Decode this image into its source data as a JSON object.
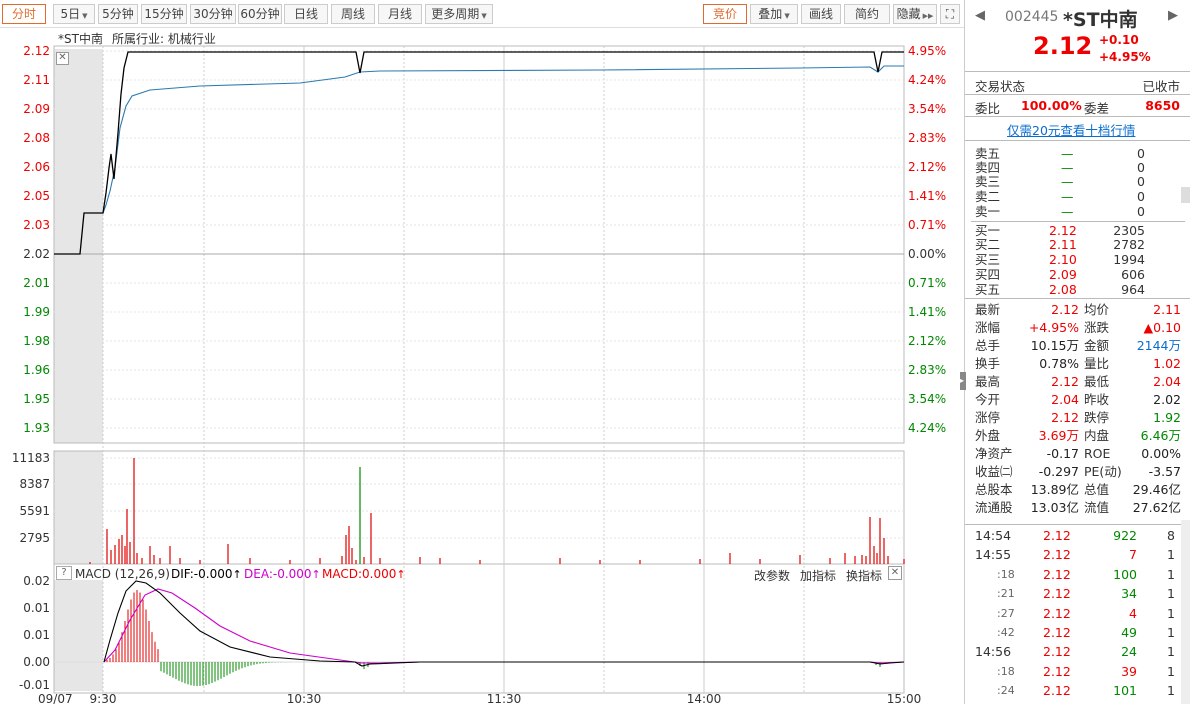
{
  "toolbar": {
    "tabs": [
      "分时",
      "5日",
      "5分钟",
      "15分钟",
      "30分钟",
      "60分钟",
      "日线",
      "周线",
      "月线",
      "更多周期"
    ],
    "right_tabs": [
      "竞价",
      "叠加",
      "画线",
      "简约",
      "隐藏"
    ]
  },
  "chart": {
    "title": "*ST中南",
    "industry": "所属行业: 机械行业",
    "price_ticks": [
      "2.12",
      "2.11",
      "2.09",
      "2.08",
      "2.06",
      "2.05",
      "2.03",
      "2.02",
      "2.01",
      "1.99",
      "1.98",
      "1.96",
      "1.95",
      "1.93"
    ],
    "pct_ticks": [
      "4.95%",
      "4.24%",
      "3.54%",
      "2.83%",
      "2.12%",
      "1.41%",
      "0.71%",
      "0.00%",
      "0.71%",
      "1.41%",
      "2.12%",
      "2.83%",
      "3.54%",
      "4.24%"
    ],
    "vol_ticks": [
      "11183",
      "8387",
      "5591",
      "2795"
    ],
    "macd_ticks": [
      "0.02",
      "0.01",
      "0.01",
      "0.00",
      "-0.01"
    ],
    "time_ticks": [
      "09/07",
      "9:30",
      "10:30",
      "11:30",
      "14:00",
      "15:00"
    ],
    "macd_header": {
      "label": "MACD (12,26,9)",
      "dif": "DIF:-0.000",
      "dea": "DEA:-0.000",
      "macd": "MACD:0.000",
      "adjust": "改参数",
      "add": "加指标",
      "swap": "换指标"
    },
    "colors": {
      "price": "#000000",
      "avg": "#2a7ab0",
      "up": "#e00000",
      "down": "#008800",
      "dif": "#000000",
      "dea": "#cc00cc"
    }
  },
  "chart_data": [
    {
      "type": "line",
      "title": "*ST中南",
      "x": [
        "9:30",
        "9:32",
        "9:33",
        "9:35",
        "9:37",
        "9:38",
        "9:40",
        "10:00",
        "10:30",
        "11:00",
        "11:20",
        "11:23",
        "11:30",
        "13:00",
        "14:00",
        "14:50",
        "14:51",
        "14:52",
        "15:00"
      ],
      "series": [
        {
          "values": [
            2.03,
            2.03,
            2.06,
            2.05,
            2.11,
            2.12,
            2.12,
            2.12,
            2.12,
            2.12,
            2.12,
            2.115,
            2.12,
            2.12,
            2.12,
            2.12,
            2.115,
            2.12,
            2.12
          ]
        },
        {
          "values": [
            2.03,
            2.03,
            2.045,
            2.05,
            2.08,
            2.095,
            2.1,
            2.103,
            2.104,
            2.105,
            2.107,
            2.109,
            2.11,
            2.11,
            2.11,
            2.112,
            2.111,
            2.112,
            2.112
          ]
        }
      ],
      "ylim": [
        1.92,
        2.12
      ],
      "y_axis_left": [
        "2.12",
        "2.11",
        "2.09",
        "2.08",
        "2.06",
        "2.05",
        "2.03",
        "2.02",
        "2.01",
        "1.99",
        "1.98",
        "1.96",
        "1.95",
        "1.93"
      ],
      "y_axis_right": [
        "4.95%",
        "4.24%",
        "3.54%",
        "2.83%",
        "2.12%",
        "1.41%",
        "0.71%",
        "0.00%",
        "0.71%",
        "1.41%",
        "2.12%",
        "2.83%",
        "3.54%",
        "4.24%"
      ]
    },
    {
      "type": "bar",
      "ylim": [
        0,
        11183
      ],
      "y_ticks": [
        "11183",
        "8387",
        "5591",
        "2795"
      ]
    },
    {
      "type": "bar",
      "ylim": [
        -0.01,
        0.02
      ],
      "y_ticks": [
        "0.02",
        "0.01",
        "0.01",
        "0.00",
        "-0.01"
      ],
      "series": [
        {
          "name": "MACD"
        },
        {
          "name": "DIF"
        },
        {
          "name": "DEA"
        }
      ]
    }
  ],
  "quote": {
    "code": "002445",
    "name": "*ST中南",
    "price": "2.12",
    "change": "+0.10",
    "change_pct": "+4.95%",
    "status_label": "交易状态",
    "status_value": "已收市",
    "weibi_label": "委比",
    "weibi_value": "100.00%",
    "weicha_label": "委差",
    "weicha_value": "8650",
    "link": "仅需20元查看十档行情",
    "asks": [
      {
        "label": "卖五",
        "price": "—",
        "vol": "0"
      },
      {
        "label": "卖四",
        "price": "—",
        "vol": "0"
      },
      {
        "label": "卖三",
        "price": "—",
        "vol": "0"
      },
      {
        "label": "卖二",
        "price": "—",
        "vol": "0"
      },
      {
        "label": "卖一",
        "price": "—",
        "vol": "0"
      }
    ],
    "bids": [
      {
        "label": "买一",
        "price": "2.12",
        "vol": "2305"
      },
      {
        "label": "买二",
        "price": "2.11",
        "vol": "2782"
      },
      {
        "label": "买三",
        "price": "2.10",
        "vol": "1994"
      },
      {
        "label": "买四",
        "price": "2.09",
        "vol": "606"
      },
      {
        "label": "买五",
        "price": "2.08",
        "vol": "964"
      }
    ],
    "stats": [
      {
        "l1": "最新",
        "v1": "2.12",
        "c1": "r",
        "l2": "均价",
        "v2": "2.11",
        "c2": "r"
      },
      {
        "l1": "涨幅",
        "v1": "+4.95%",
        "c1": "r",
        "l2": "涨跌",
        "v2": "▲0.10",
        "c2": "r"
      },
      {
        "l1": "总手",
        "v1": "10.15万",
        "c1": "k",
        "l2": "金额",
        "v2": "2144万",
        "c2": "b"
      },
      {
        "l1": "换手",
        "v1": "0.78%",
        "c1": "k",
        "l2": "量比",
        "v2": "1.02",
        "c2": "r"
      },
      {
        "l1": "最高",
        "v1": "2.12",
        "c1": "r",
        "l2": "最低",
        "v2": "2.04",
        "c2": "r"
      },
      {
        "l1": "今开",
        "v1": "2.04",
        "c1": "r",
        "l2": "昨收",
        "v2": "2.02",
        "c2": "k"
      },
      {
        "l1": "涨停",
        "v1": "2.12",
        "c1": "r",
        "l2": "跌停",
        "v2": "1.92",
        "c2": "g"
      },
      {
        "l1": "外盘",
        "v1": "3.69万",
        "c1": "r",
        "l2": "内盘",
        "v2": "6.46万",
        "c2": "g"
      },
      {
        "l1": "净资产",
        "v1": "-0.17",
        "c1": "k",
        "l2": "ROE",
        "v2": "0.00%",
        "c2": "k"
      },
      {
        "l1": "收益㈡",
        "v1": "-0.297",
        "c1": "k",
        "l2": "PE(动)",
        "v2": "-3.57",
        "c2": "k"
      },
      {
        "l1": "总股本",
        "v1": "13.89亿",
        "c1": "k",
        "l2": "总值",
        "v2": "29.46亿",
        "c2": "k"
      },
      {
        "l1": "流通股",
        "v1": "13.03亿",
        "c1": "k",
        "l2": "流值",
        "v2": "27.62亿",
        "c2": "k"
      }
    ],
    "ticks": [
      {
        "time": "14:54",
        "price": "2.12",
        "vol": "922",
        "cnt": "8",
        "major": true
      },
      {
        "time": "14:55",
        "price": "2.12",
        "vol": "7",
        "cnt": "1",
        "major": true
      },
      {
        "time": ":18",
        "price": "2.12",
        "vol": "100",
        "cnt": "1",
        "major": false
      },
      {
        "time": ":21",
        "price": "2.12",
        "vol": "34",
        "cnt": "1",
        "major": false
      },
      {
        "time": ":27",
        "price": "2.12",
        "vol": "4",
        "cnt": "1",
        "major": false
      },
      {
        "time": ":42",
        "price": "2.12",
        "vol": "49",
        "cnt": "1",
        "major": false
      },
      {
        "time": "14:56",
        "price": "2.12",
        "vol": "24",
        "cnt": "1",
        "major": true
      },
      {
        "time": ":18",
        "price": "2.12",
        "vol": "39",
        "cnt": "1",
        "major": false
      },
      {
        "time": ":24",
        "price": "2.12",
        "vol": "101",
        "cnt": "1",
        "major": false
      }
    ]
  }
}
